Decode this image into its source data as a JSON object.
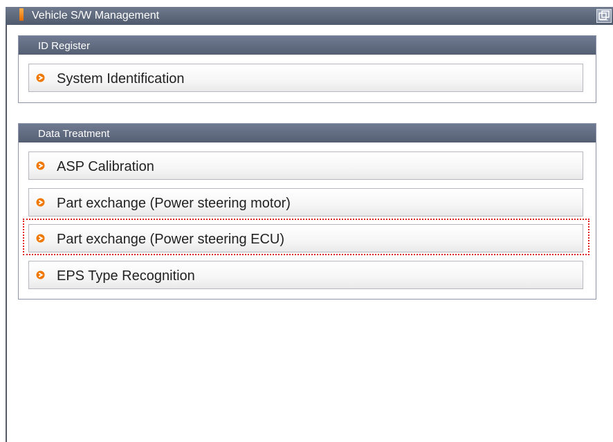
{
  "window": {
    "title": "Vehicle S/W Management"
  },
  "sections": [
    {
      "header": "ID Register",
      "items": [
        {
          "label": "System Identification"
        }
      ]
    },
    {
      "header": "Data Treatment",
      "items": [
        {
          "label": "ASP Calibration"
        },
        {
          "label": "Part exchange (Power steering motor)"
        },
        {
          "label": "Part exchange (Power steering ECU)"
        },
        {
          "label": "EPS Type Recognition"
        }
      ]
    }
  ],
  "highlighted_item": "Part exchange (Power steering ECU)",
  "colors": {
    "title_bar": "#5f6a7e",
    "section_header": "#626d84",
    "bullet": "#f07800",
    "highlight_outline": "#e02020"
  },
  "icons": {
    "title_marker": "orange-bar-icon",
    "bullet": "orange-bullet-icon",
    "window_control": "window-restore-icon"
  }
}
